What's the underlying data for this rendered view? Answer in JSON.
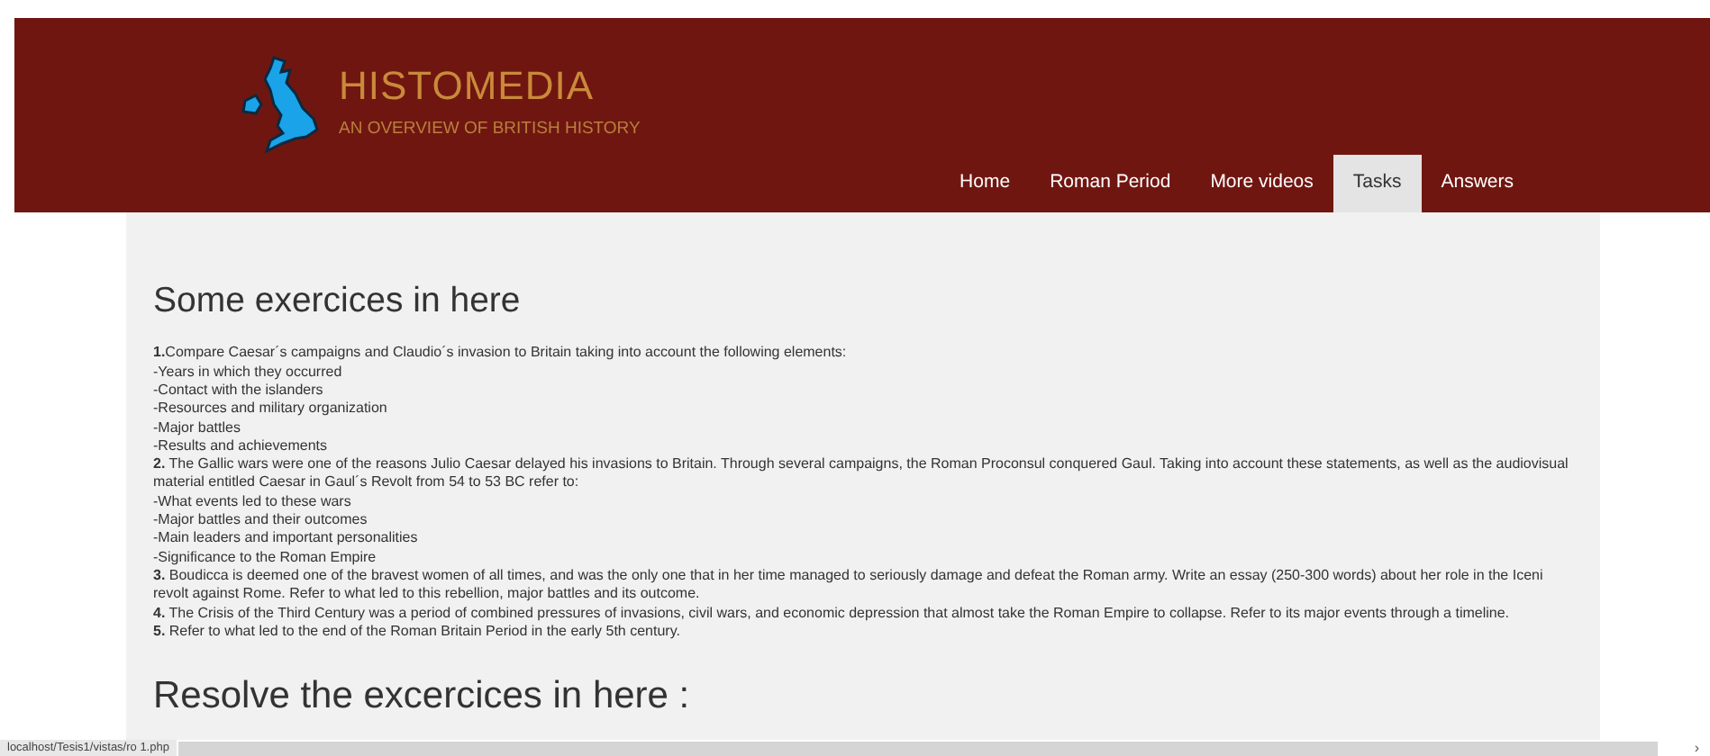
{
  "header": {
    "title": "HISTOMEDIA",
    "subtitle": "AN OVERVIEW OF BRITISH HISTORY"
  },
  "nav": [
    {
      "label": "Home",
      "selected": false
    },
    {
      "label": "Roman Period",
      "selected": false
    },
    {
      "label": "More videos",
      "selected": false
    },
    {
      "label": "Tasks",
      "selected": true
    },
    {
      "label": "Answers",
      "selected": false
    }
  ],
  "heading": "Some exercices in here",
  "lines": [
    "**1.**Compare Caesar´s campaigns and Claudio´s invasion to Britain taking into account the following elements:",
    "-Years in which they occurred",
    "-Contact with the islanders",
    "-Resources and military organization",
    "-Major battles",
    "-Results and achievements",
    "**2.** The Gallic wars were one of the reasons Julio Caesar delayed his invasions to Britain. Through several campaigns, the Roman Proconsul conquered Gaul. Taking into account these statements, as well as the audiovisual material entitled Caesar in Gaul´s Revolt from 54 to 53 BC refer to:",
    "-What events led to these wars",
    "-Major battles and their outcomes",
    "-Main leaders and important personalities",
    "-Significance to the Roman Empire",
    "**3.** Boudicca is deemed one of the bravest women of all times, and was the only one that in her time managed to seriously damage and defeat the Roman army. Write an essay (250-300 words) about her role in the Iceni revolt against Rome. Refer to what led to this rebellion, major battles and its outcome.",
    "**4.** The Crisis of the Third Century was a period of combined pressures of invasions, civil wars, and economic depression that almost take the Roman Empire to collapse. Refer to its major events through a timeline.",
    "**5.** Refer to what led to the end of the Roman Britain Period in the early 5th century."
  ],
  "heading_2": "Resolve the excercices in here :",
  "status_bar": {
    "url": "localhost/Tesis1/vistas/ro 1.php",
    "arrow": "›"
  }
}
